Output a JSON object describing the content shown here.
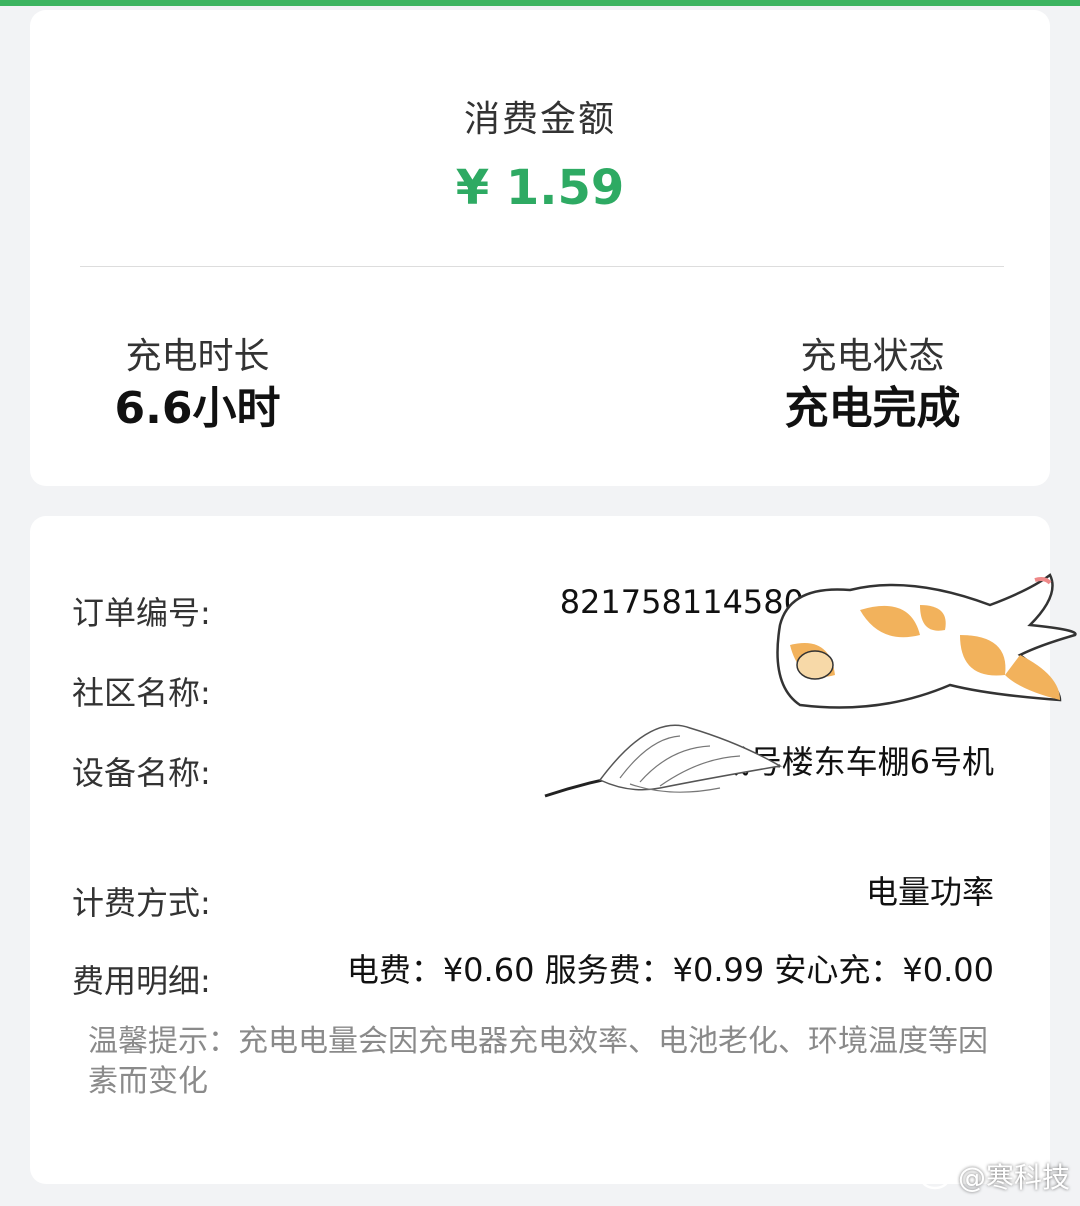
{
  "summary": {
    "amount_title": "消费金额",
    "amount_value": "¥ 1.59",
    "duration_label": "充电时长",
    "duration_value": "6.6小时",
    "status_label": "充电状态",
    "status_value": "充电完成"
  },
  "details": {
    "order_label": "订单编号:",
    "order_value": "821758114580",
    "community_label": "社区名称:",
    "community_value": "",
    "device_label": "设备名称:",
    "device_value": "龙城号楼东车棚6号机",
    "billing_label": "计费方式:",
    "billing_value": "电量功率",
    "fee_label": "费用明细:",
    "fee_value": "电费：¥0.60 服务费：¥0.99 安心充：¥0.00",
    "tip": "温馨提示：充电电量会因充电器充电效率、电池老化、环境温度等因素而变化"
  },
  "watermark": {
    "text": "@寒科技",
    "icon": "weibo-icon"
  },
  "colors": {
    "accent": "#2eaa63",
    "top_bar": "#3cb460",
    "background": "#f2f3f5"
  }
}
